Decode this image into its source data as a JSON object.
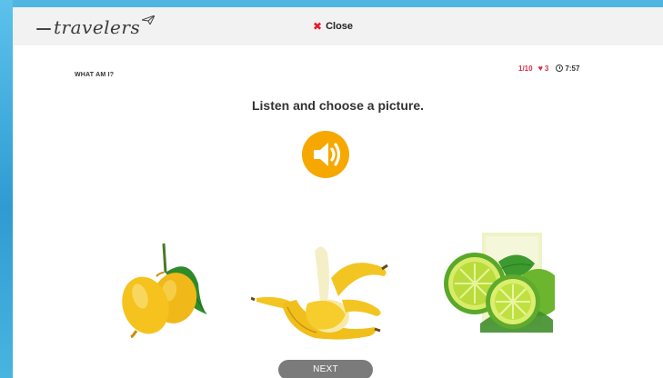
{
  "header": {
    "logo_text": "travelers",
    "close_label": "Close"
  },
  "quiz": {
    "section_label": "WHAT AM I?",
    "progress": "1/10",
    "lives": "3",
    "timer": "7:57",
    "instruction": "Listen and choose a picture.",
    "choices": [
      {
        "image": "lemon-image"
      },
      {
        "image": "banana-image"
      },
      {
        "image": "lime-image"
      }
    ],
    "next_label": "NEXT"
  },
  "colors": {
    "accent": "#f6a800",
    "danger": "#e8192c",
    "stat_red": "#d6304a",
    "next_button": "#7b7b7b",
    "background": "#4ab4e0"
  }
}
